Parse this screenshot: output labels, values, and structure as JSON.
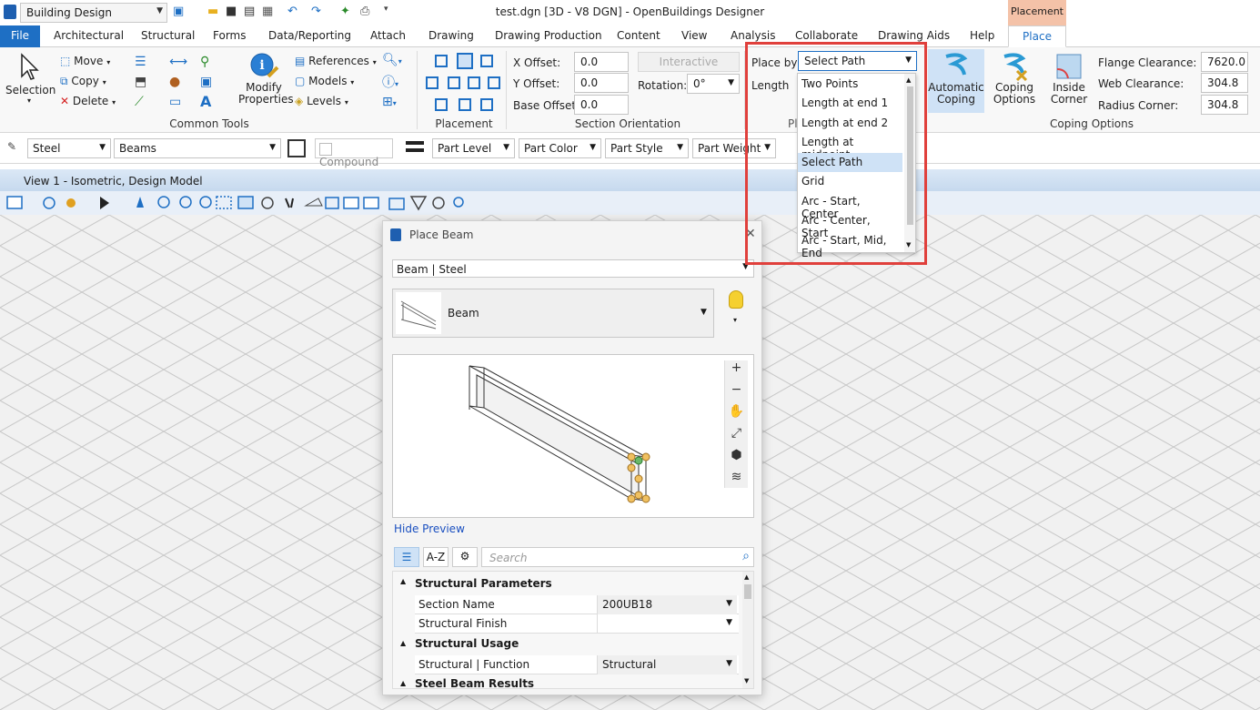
{
  "titlebar": {
    "workflow": "Building Design",
    "title": "test.dgn [3D - V8 DGN] - OpenBuildings Designer",
    "context_tab": "Placement"
  },
  "tabs": [
    "File",
    "Architectural",
    "Structural",
    "Forms",
    "Data/Reporting",
    "Attach",
    "Drawing",
    "Drawing Production",
    "Content",
    "View",
    "Analysis",
    "Collaborate",
    "Drawing Aids",
    "Help",
    "Place"
  ],
  "ribbon": {
    "selection": "Selection",
    "move": "Move",
    "copy": "Copy",
    "delete": "Delete",
    "modify_properties": "Modify Properties",
    "references": "References",
    "models": "Models",
    "levels": "Levels",
    "common_tools": "Common Tools",
    "placement": "Placement",
    "x_offset_label": "X Offset:",
    "x_offset": "0.0",
    "y_offset_label": "Y Offset:",
    "y_offset": "0.0",
    "base_offset_label": "Base Offset:",
    "base_offset": "0.0",
    "interactive": "Interactive",
    "rotation_label": "Rotation:",
    "rotation": "0°",
    "section_orientation": "Section Orientation",
    "place_by_label": "Place by:",
    "place_by": "Select Path",
    "length_label": "Length",
    "pl_trunc": "Pl",
    "automatic_coping": "Automatic Coping",
    "coping_options": "Coping Options",
    "inside_corner": "Inside Corner",
    "flange_clearance_label": "Flange Clearance:",
    "flange_clearance": "7620.0",
    "web_clearance_label": "Web Clearance:",
    "web_clearance": "304.8",
    "radius_corner_label": "Radius Corner:",
    "radius_corner": "304.8",
    "coping_options_group": "Coping Options"
  },
  "place_by_options": [
    "Two Points",
    "Length at end 1",
    "Length at end 2",
    "Length at midpoint",
    "Select Path",
    "Grid",
    "Arc - Start, Center",
    "Arc - Center, Start",
    "Arc - Start, Mid, End"
  ],
  "attrbar": {
    "material": "Steel",
    "family": "Beams",
    "compound": "Compound",
    "part_level": "Part Level",
    "part_color": "Part Color",
    "part_style": "Part Style",
    "part_weight": "Part Weight"
  },
  "view": {
    "title": "View 1 - Isometric, Design Model"
  },
  "dialog": {
    "title": "Place Beam",
    "type": "Beam | Steel",
    "item": "Beam",
    "hide_preview": "Hide Preview",
    "az": "A-Z",
    "search_placeholder": "Search",
    "section_structural_parameters": "Structural Parameters",
    "section_name_label": "Section Name",
    "section_name": "200UB18",
    "structural_finish_label": "Structural Finish",
    "structural_finish": "",
    "section_structural_usage": "Structural Usage",
    "function_label": "Structural | Function",
    "function": "Structural",
    "section_steel_beam_results": "Steel Beam Results"
  },
  "colors": {
    "accent": "#1e6fc4",
    "highlight": "#e0403c",
    "context_tab": "#f4c2a8"
  }
}
